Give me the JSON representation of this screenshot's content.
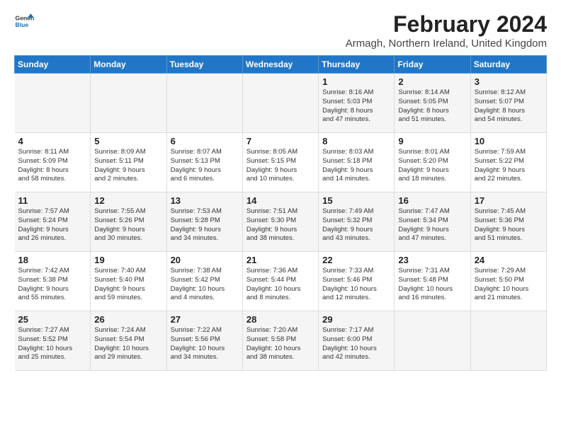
{
  "logo": {
    "text_general": "General",
    "text_blue": "Blue"
  },
  "title": "February 2024",
  "subtitle": "Armagh, Northern Ireland, United Kingdom",
  "days_of_week": [
    "Sunday",
    "Monday",
    "Tuesday",
    "Wednesday",
    "Thursday",
    "Friday",
    "Saturday"
  ],
  "weeks": [
    [
      {
        "day": "",
        "lines": []
      },
      {
        "day": "",
        "lines": []
      },
      {
        "day": "",
        "lines": []
      },
      {
        "day": "",
        "lines": []
      },
      {
        "day": "1",
        "lines": [
          "Sunrise: 8:16 AM",
          "Sunset: 5:03 PM",
          "Daylight: 8 hours",
          "and 47 minutes."
        ]
      },
      {
        "day": "2",
        "lines": [
          "Sunrise: 8:14 AM",
          "Sunset: 5:05 PM",
          "Daylight: 8 hours",
          "and 51 minutes."
        ]
      },
      {
        "day": "3",
        "lines": [
          "Sunrise: 8:12 AM",
          "Sunset: 5:07 PM",
          "Daylight: 8 hours",
          "and 54 minutes."
        ]
      }
    ],
    [
      {
        "day": "4",
        "lines": [
          "Sunrise: 8:11 AM",
          "Sunset: 5:09 PM",
          "Daylight: 8 hours",
          "and 58 minutes."
        ]
      },
      {
        "day": "5",
        "lines": [
          "Sunrise: 8:09 AM",
          "Sunset: 5:11 PM",
          "Daylight: 9 hours",
          "and 2 minutes."
        ]
      },
      {
        "day": "6",
        "lines": [
          "Sunrise: 8:07 AM",
          "Sunset: 5:13 PM",
          "Daylight: 9 hours",
          "and 6 minutes."
        ]
      },
      {
        "day": "7",
        "lines": [
          "Sunrise: 8:05 AM",
          "Sunset: 5:15 PM",
          "Daylight: 9 hours",
          "and 10 minutes."
        ]
      },
      {
        "day": "8",
        "lines": [
          "Sunrise: 8:03 AM",
          "Sunset: 5:18 PM",
          "Daylight: 9 hours",
          "and 14 minutes."
        ]
      },
      {
        "day": "9",
        "lines": [
          "Sunrise: 8:01 AM",
          "Sunset: 5:20 PM",
          "Daylight: 9 hours",
          "and 18 minutes."
        ]
      },
      {
        "day": "10",
        "lines": [
          "Sunrise: 7:59 AM",
          "Sunset: 5:22 PM",
          "Daylight: 9 hours",
          "and 22 minutes."
        ]
      }
    ],
    [
      {
        "day": "11",
        "lines": [
          "Sunrise: 7:57 AM",
          "Sunset: 5:24 PM",
          "Daylight: 9 hours",
          "and 26 minutes."
        ]
      },
      {
        "day": "12",
        "lines": [
          "Sunrise: 7:55 AM",
          "Sunset: 5:26 PM",
          "Daylight: 9 hours",
          "and 30 minutes."
        ]
      },
      {
        "day": "13",
        "lines": [
          "Sunrise: 7:53 AM",
          "Sunset: 5:28 PM",
          "Daylight: 9 hours",
          "and 34 minutes."
        ]
      },
      {
        "day": "14",
        "lines": [
          "Sunrise: 7:51 AM",
          "Sunset: 5:30 PM",
          "Daylight: 9 hours",
          "and 38 minutes."
        ]
      },
      {
        "day": "15",
        "lines": [
          "Sunrise: 7:49 AM",
          "Sunset: 5:32 PM",
          "Daylight: 9 hours",
          "and 43 minutes."
        ]
      },
      {
        "day": "16",
        "lines": [
          "Sunrise: 7:47 AM",
          "Sunset: 5:34 PM",
          "Daylight: 9 hours",
          "and 47 minutes."
        ]
      },
      {
        "day": "17",
        "lines": [
          "Sunrise: 7:45 AM",
          "Sunset: 5:36 PM",
          "Daylight: 9 hours",
          "and 51 minutes."
        ]
      }
    ],
    [
      {
        "day": "18",
        "lines": [
          "Sunrise: 7:42 AM",
          "Sunset: 5:38 PM",
          "Daylight: 9 hours",
          "and 55 minutes."
        ]
      },
      {
        "day": "19",
        "lines": [
          "Sunrise: 7:40 AM",
          "Sunset: 5:40 PM",
          "Daylight: 9 hours",
          "and 59 minutes."
        ]
      },
      {
        "day": "20",
        "lines": [
          "Sunrise: 7:38 AM",
          "Sunset: 5:42 PM",
          "Daylight: 10 hours",
          "and 4 minutes."
        ]
      },
      {
        "day": "21",
        "lines": [
          "Sunrise: 7:36 AM",
          "Sunset: 5:44 PM",
          "Daylight: 10 hours",
          "and 8 minutes."
        ]
      },
      {
        "day": "22",
        "lines": [
          "Sunrise: 7:33 AM",
          "Sunset: 5:46 PM",
          "Daylight: 10 hours",
          "and 12 minutes."
        ]
      },
      {
        "day": "23",
        "lines": [
          "Sunrise: 7:31 AM",
          "Sunset: 5:48 PM",
          "Daylight: 10 hours",
          "and 16 minutes."
        ]
      },
      {
        "day": "24",
        "lines": [
          "Sunrise: 7:29 AM",
          "Sunset: 5:50 PM",
          "Daylight: 10 hours",
          "and 21 minutes."
        ]
      }
    ],
    [
      {
        "day": "25",
        "lines": [
          "Sunrise: 7:27 AM",
          "Sunset: 5:52 PM",
          "Daylight: 10 hours",
          "and 25 minutes."
        ]
      },
      {
        "day": "26",
        "lines": [
          "Sunrise: 7:24 AM",
          "Sunset: 5:54 PM",
          "Daylight: 10 hours",
          "and 29 minutes."
        ]
      },
      {
        "day": "27",
        "lines": [
          "Sunrise: 7:22 AM",
          "Sunset: 5:56 PM",
          "Daylight: 10 hours",
          "and 34 minutes."
        ]
      },
      {
        "day": "28",
        "lines": [
          "Sunrise: 7:20 AM",
          "Sunset: 5:58 PM",
          "Daylight: 10 hours",
          "and 38 minutes."
        ]
      },
      {
        "day": "29",
        "lines": [
          "Sunrise: 7:17 AM",
          "Sunset: 6:00 PM",
          "Daylight: 10 hours",
          "and 42 minutes."
        ]
      },
      {
        "day": "",
        "lines": []
      },
      {
        "day": "",
        "lines": []
      }
    ]
  ]
}
